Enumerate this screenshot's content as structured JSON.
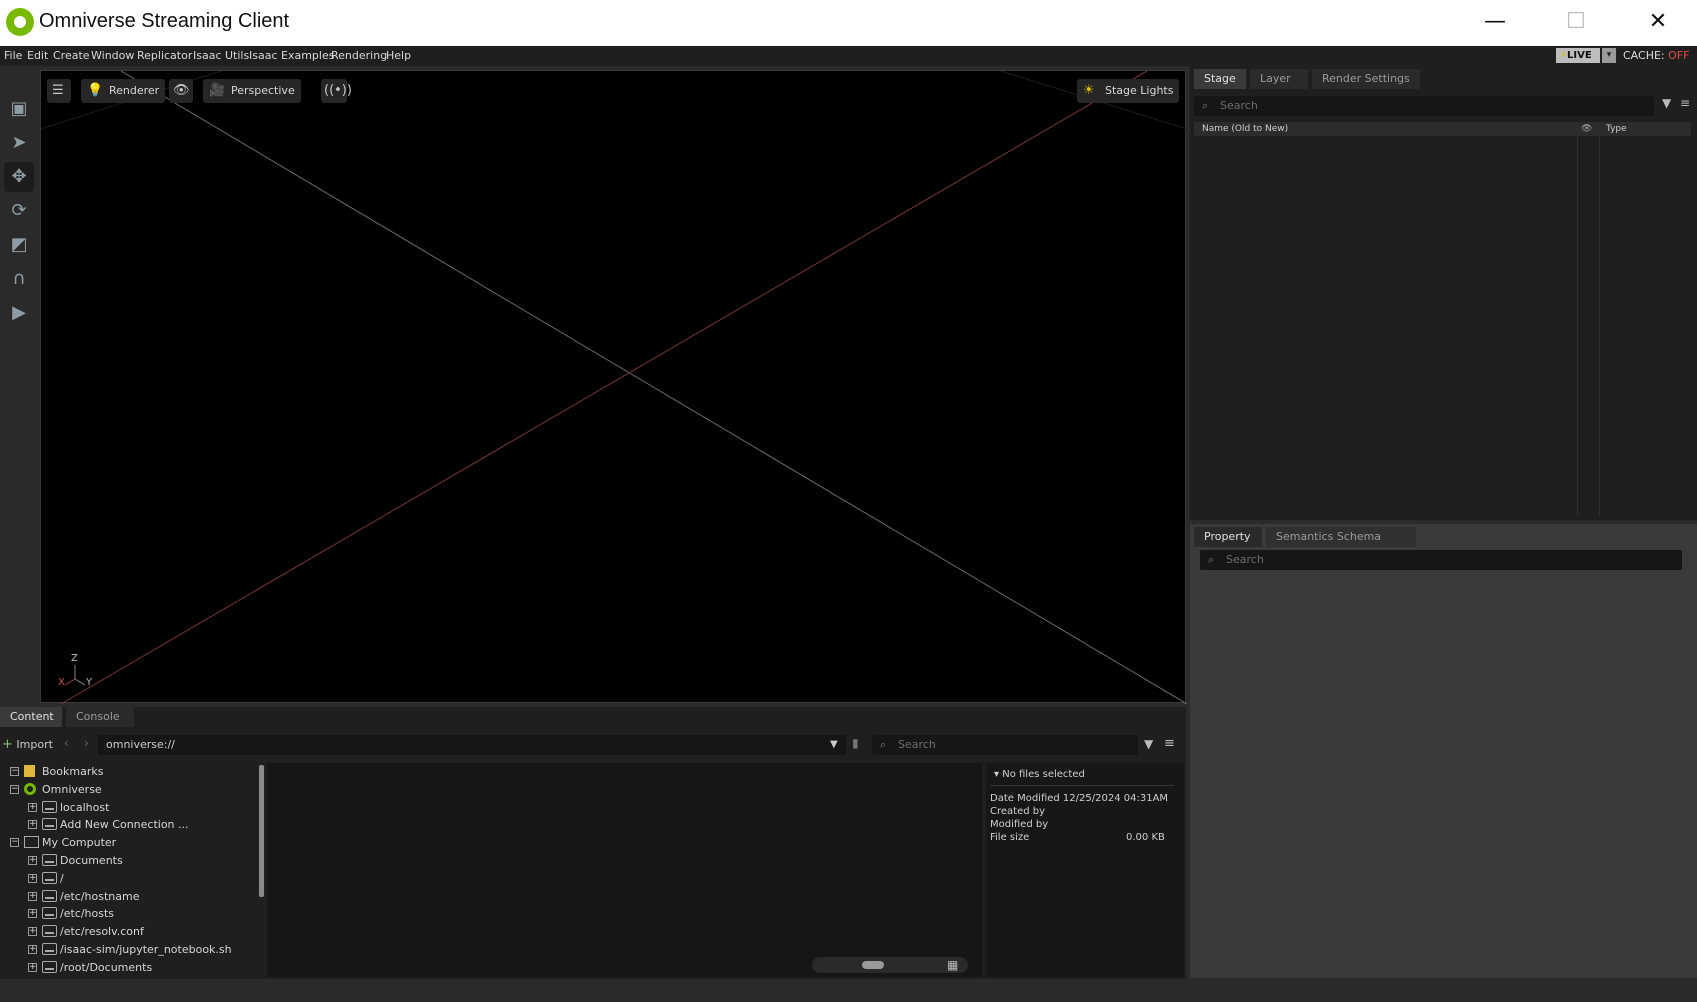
{
  "window": {
    "title": "Omniverse Streaming Client",
    "minimize": "—",
    "maximize": "☐",
    "close": "✕"
  },
  "menu": {
    "items": [
      "File",
      "Edit",
      "Create",
      "Window",
      "Replicator",
      "Isaac Utils",
      "Isaac Examples",
      "Rendering",
      "Help"
    ],
    "live": "LIVE",
    "cache_label": "CACHE:",
    "cache_state": "OFF"
  },
  "viewport": {
    "renderer": "Renderer",
    "camera": "Perspective",
    "stage_lights": "Stage Lights",
    "axis": {
      "z": "Z",
      "x": "X",
      "y": "Y"
    }
  },
  "stage_panel": {
    "tabs": [
      "Stage",
      "Layer",
      "Render Settings"
    ],
    "search_placeholder": "Search",
    "col_name": "Name (Old to New)",
    "col_type": "Type"
  },
  "property_panel": {
    "tabs": [
      "Property",
      "Semantics Schema Editor"
    ],
    "search_placeholder": "Search"
  },
  "content_panel": {
    "tabs": [
      "Content",
      "Console"
    ],
    "import": "Import",
    "path": "omniverse://",
    "search_placeholder": "Search",
    "tree": [
      {
        "label": "Bookmarks",
        "level": 0,
        "exp": "−",
        "icon": "bookmark"
      },
      {
        "label": "Omniverse",
        "level": 0,
        "exp": "−",
        "icon": "omni"
      },
      {
        "label": "localhost",
        "level": 1,
        "exp": "+",
        "icon": "drive"
      },
      {
        "label": "Add New Connection ...",
        "level": 1,
        "exp": "+",
        "icon": "drive"
      },
      {
        "label": "My Computer",
        "level": 0,
        "exp": "−",
        "icon": "computer"
      },
      {
        "label": "Documents",
        "level": 1,
        "exp": "+",
        "icon": "drive"
      },
      {
        "label": "/",
        "level": 1,
        "exp": "+",
        "icon": "drive"
      },
      {
        "label": "/etc/hostname",
        "level": 1,
        "exp": "+",
        "icon": "drive"
      },
      {
        "label": "/etc/hosts",
        "level": 1,
        "exp": "+",
        "icon": "drive"
      },
      {
        "label": "/etc/resolv.conf",
        "level": 1,
        "exp": "+",
        "icon": "drive"
      },
      {
        "label": "/isaac-sim/jupyter_notebook.sh",
        "level": 1,
        "exp": "+",
        "icon": "drive"
      },
      {
        "label": "/root/Documents",
        "level": 1,
        "exp": "+",
        "icon": "drive"
      }
    ],
    "details": {
      "header": "No files selected",
      "date_modified": "Date Modified 12/25/2024 04:31AM",
      "created_by": "Created by",
      "modified_by": "Modified by",
      "file_size_label": "File size",
      "file_size_value": "0.00 KB"
    }
  }
}
